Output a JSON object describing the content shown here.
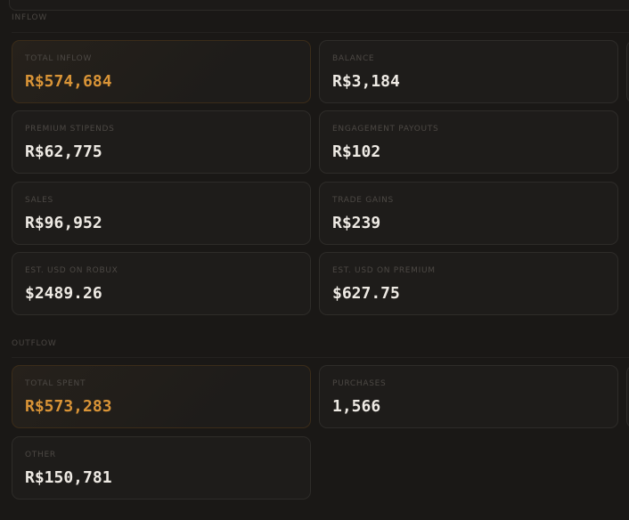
{
  "inflow": {
    "heading": "INFLOW",
    "cards": [
      {
        "label": "TOTAL INFLOW",
        "value": "R$574,684"
      },
      {
        "label": "BALANCE",
        "value": "R$3,184"
      },
      {
        "label": "PREMIUM STIPENDS",
        "value": "R$62,775"
      },
      {
        "label": "ENGAGEMENT PAYOUTS",
        "value": "R$102"
      },
      {
        "label": "SALES",
        "value": "R$96,952"
      },
      {
        "label": "TRADE GAINS",
        "value": "R$239"
      },
      {
        "label": "EST. USD ON ROBUX",
        "value": "$2489.26"
      },
      {
        "label": "EST. USD ON PREMIUM",
        "value": "$627.75"
      }
    ]
  },
  "outflow": {
    "heading": "OUTFLOW",
    "cards": [
      {
        "label": "TOTAL SPENT",
        "value": "R$573,283"
      },
      {
        "label": "PURCHASES",
        "value": "1,566"
      },
      {
        "label": "OTHER",
        "value": "R$150,781"
      }
    ]
  },
  "colors": {
    "background": "#1a1816",
    "card": "#1e1c1a",
    "accent": "#d99437",
    "value": "#eeeae4",
    "label": "#4c4844"
  }
}
